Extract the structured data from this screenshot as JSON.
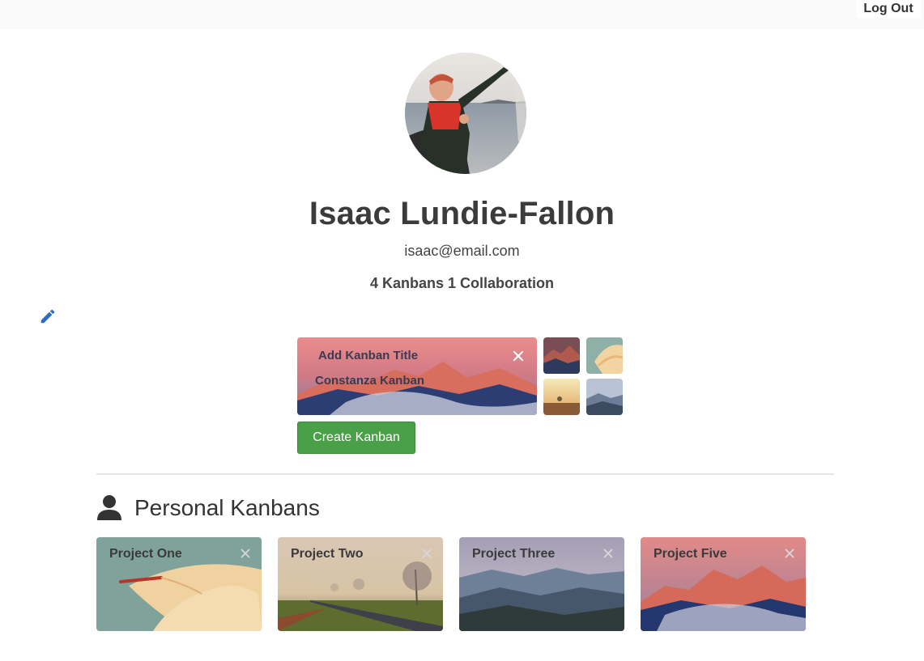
{
  "header": {
    "logout_label": "Log Out"
  },
  "profile": {
    "name": "Isaac Lundie-Fallon",
    "email": "isaac@email.com",
    "stats": "4 Kanbans 1 Collaboration"
  },
  "new_kanban": {
    "title_placeholder": "Add Kanban Title",
    "subtitle": "Constanza Kanban",
    "create_label": "Create Kanban",
    "backgrounds": [
      "mountain-dusk",
      "flower-petals",
      "field-sunrise",
      "mountain-valley"
    ]
  },
  "personal": {
    "section_title": "Personal Kanbans",
    "projects": [
      {
        "title": "Project One",
        "background": "flower-petals"
      },
      {
        "title": "Project Two",
        "background": "misty-road"
      },
      {
        "title": "Project Three",
        "background": "mountain-valley"
      },
      {
        "title": "Project Five",
        "background": "pink-peaks"
      }
    ]
  },
  "colors": {
    "accent_green": "#4aa046",
    "edit_blue": "#2b6cc4",
    "text": "#3b3b3b"
  }
}
